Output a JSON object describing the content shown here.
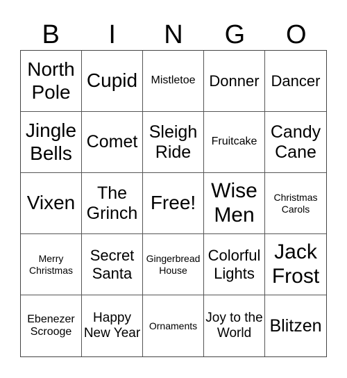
{
  "header": [
    "B",
    "I",
    "N",
    "G",
    "O"
  ],
  "cells": [
    "North Pole",
    "Cupid",
    "Mistletoe",
    "Donner",
    "Dancer",
    "Jingle Bells",
    "Comet",
    "Sleigh Ride",
    "Fruitcake",
    "Candy Cane",
    "Vixen",
    "The Grinch",
    "Free!",
    "Wise Men",
    "Christmas Carols",
    "Merry Christmas",
    "Secret Santa",
    "Gingerbread House",
    "Colorful Lights",
    "Jack Frost",
    "Ebenezer Scrooge",
    "Happy New Year",
    "Ornaments",
    "Joy to the World",
    "Blitzen"
  ]
}
